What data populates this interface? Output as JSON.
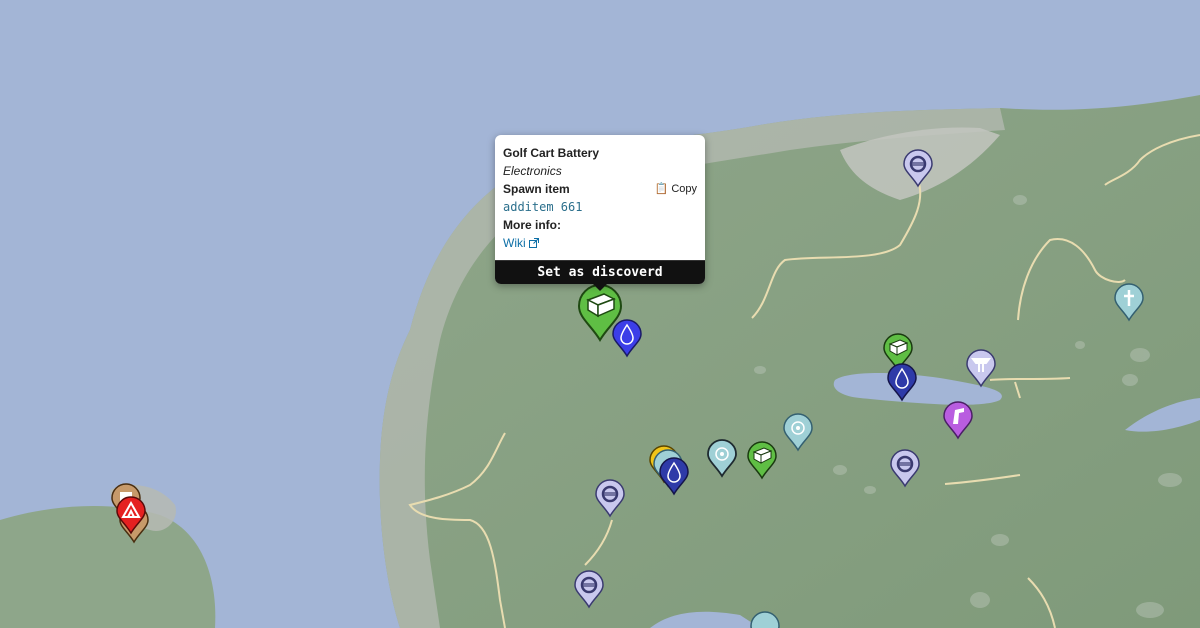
{
  "popup": {
    "title": "Golf Cart Battery",
    "category": "Electronics",
    "spawn_label": "Spawn item",
    "copy_label": "Copy",
    "spawn_code": "additem 661",
    "more_info_label": "More info:",
    "wiki_label": "Wiki",
    "discover_button": "Set as discoverd"
  },
  "markers": [
    {
      "type": "selected-item",
      "icon": "battery-icon",
      "color": "#5fbe44"
    },
    {
      "type": "item",
      "icon": "battery-icon",
      "color": "#5fbe44"
    },
    {
      "type": "item",
      "icon": "battery-icon",
      "color": "#5fbe44"
    },
    {
      "type": "water",
      "icon": "water-drop-icon",
      "color": "#3c3ee8"
    },
    {
      "type": "water",
      "icon": "water-drop-icon",
      "color": "#2e3aa8"
    },
    {
      "type": "water",
      "icon": "water-drop-icon",
      "color": "#2e3aa8"
    },
    {
      "type": "gas",
      "icon": "gas-pump-icon",
      "color": "#b95de0"
    },
    {
      "type": "tire",
      "icon": "tire-icon",
      "color": "#c9c8ee"
    },
    {
      "type": "location",
      "icon": "target-icon",
      "color": "#9fd0d6"
    },
    {
      "type": "grave",
      "icon": "cross-icon",
      "color": "#9fd0d6"
    },
    {
      "type": "camp",
      "icon": "tent-icon",
      "color": "#e52020"
    },
    {
      "type": "table",
      "icon": "table-icon",
      "color": "#c9c8ee"
    }
  ]
}
